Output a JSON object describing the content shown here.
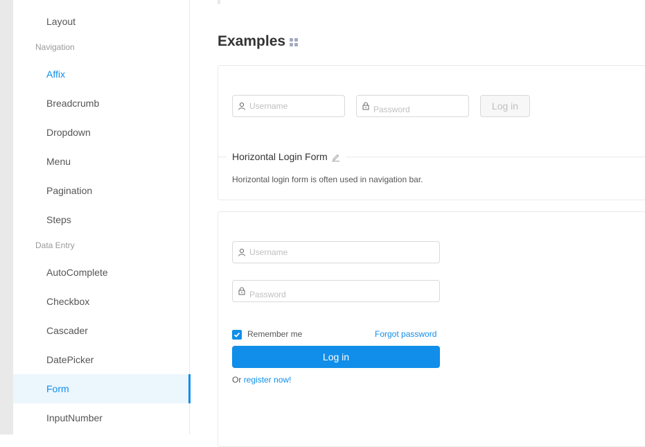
{
  "sidebar": {
    "items": [
      {
        "label": "Layout",
        "type": "item"
      },
      {
        "label": "Navigation",
        "type": "group"
      },
      {
        "label": "Affix",
        "type": "item",
        "state": "link"
      },
      {
        "label": "Breadcrumb",
        "type": "item"
      },
      {
        "label": "Dropdown",
        "type": "item"
      },
      {
        "label": "Menu",
        "type": "item"
      },
      {
        "label": "Pagination",
        "type": "item"
      },
      {
        "label": "Steps",
        "type": "item"
      },
      {
        "label": "Data Entry",
        "type": "group"
      },
      {
        "label": "AutoComplete",
        "type": "item"
      },
      {
        "label": "Checkbox",
        "type": "item"
      },
      {
        "label": "Cascader",
        "type": "item"
      },
      {
        "label": "DatePicker",
        "type": "item"
      },
      {
        "label": "Form",
        "type": "item",
        "state": "selected"
      },
      {
        "label": "InputNumber",
        "type": "item"
      }
    ]
  },
  "main": {
    "examples_title": "Examples",
    "horizontal_demo": {
      "username_placeholder": "Username",
      "password_placeholder": "Password",
      "login_label": "Log in",
      "title": "Horizontal Login Form",
      "description": "Horizontal login form is often used in navigation bar."
    },
    "normal_demo": {
      "username_placeholder": "Username",
      "password_placeholder": "Password",
      "remember_label": "Remember me",
      "remember_checked": true,
      "forgot_label": "Forgot password",
      "login_label": "Log in",
      "or_text": "Or",
      "register_label": "register now!"
    }
  },
  "colors": {
    "primary": "#108ee9",
    "selected_bg": "#ecf6fd",
    "border": "#d9d9d9"
  }
}
